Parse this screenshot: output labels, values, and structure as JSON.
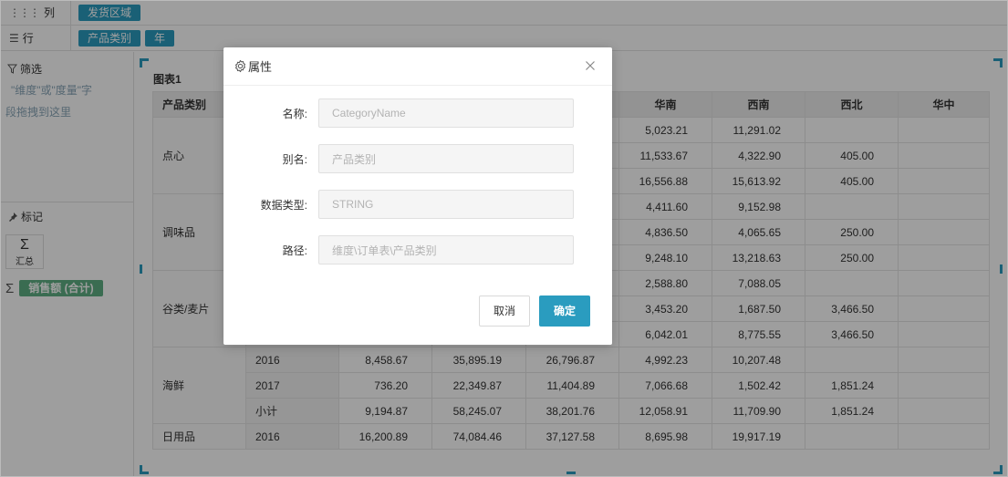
{
  "shelves": {
    "columns": {
      "label": "列",
      "pills": [
        "发货区域"
      ]
    },
    "rows": {
      "label": "行",
      "pills": [
        "产品类别",
        "年"
      ]
    }
  },
  "left_panel": {
    "filter": {
      "title": "筛选",
      "hint_line1": "\"维度\"或\"度量\"字",
      "hint_line2": "段拖拽到这里"
    },
    "marks": {
      "title": "标记",
      "sum_box_label": "汇总",
      "measure_pill": "销售额 (合计)"
    }
  },
  "chart": {
    "title": "图表1",
    "headers": [
      "产品类别",
      "",
      "",
      "",
      "",
      "华南",
      "西南",
      "西北",
      "华中"
    ],
    "categories": [
      "点心",
      "调味品",
      "谷类/麦片",
      "海鲜",
      "日用品"
    ],
    "rows": [
      {
        "cat": "",
        "year": "",
        "c1": "",
        "c2": "",
        "c3": "",
        "huanan": "5,023.21",
        "xinan": "11,291.02",
        "xibei": "",
        "huazhong": ""
      },
      {
        "cat": "",
        "year": "",
        "c1": "",
        "c2": "",
        "c3": "",
        "huanan": "11,533.67",
        "xinan": "4,322.90",
        "xibei": "405.00",
        "huazhong": ""
      },
      {
        "cat": "",
        "year": "",
        "c1": "",
        "c2": "",
        "c3": "",
        "huanan": "16,556.88",
        "xinan": "15,613.92",
        "xibei": "405.00",
        "huazhong": ""
      },
      {
        "cat": "",
        "year": "",
        "c1": "",
        "c2": "",
        "c3": "",
        "huanan": "4,411.60",
        "xinan": "9,152.98",
        "xibei": "",
        "huazhong": ""
      },
      {
        "cat": "",
        "year": "",
        "c1": "",
        "c2": "",
        "c3": "",
        "huanan": "4,836.50",
        "xinan": "4,065.65",
        "xibei": "250.00",
        "huazhong": ""
      },
      {
        "cat": "",
        "year": "",
        "c1": "",
        "c2": "",
        "c3": "",
        "huanan": "9,248.10",
        "xinan": "13,218.63",
        "xibei": "250.00",
        "huazhong": ""
      },
      {
        "cat": "",
        "year": "",
        "c1": "",
        "c2": "",
        "c3": "",
        "huanan": "2,588.80",
        "xinan": "7,088.05",
        "xibei": "",
        "huazhong": ""
      },
      {
        "cat": "",
        "year": "",
        "c1": "",
        "c2": "",
        "c3": "",
        "huanan": "3,453.20",
        "xinan": "1,687.50",
        "xibei": "3,466.50",
        "huazhong": ""
      },
      {
        "cat": "",
        "year": "",
        "c1": "",
        "c2": "",
        "c3": "",
        "huanan": "6,042.01",
        "xinan": "8,775.55",
        "xibei": "3,466.50",
        "huazhong": ""
      },
      {
        "cat": "",
        "year": "2016",
        "c1": "8,458.67",
        "c2": "35,895.19",
        "c3": "26,796.87",
        "huanan": "4,992.23",
        "xinan": "10,207.48",
        "xibei": "",
        "huazhong": ""
      },
      {
        "cat": "",
        "year": "2017",
        "c1": "736.20",
        "c2": "22,349.87",
        "c3": "11,404.89",
        "huanan": "7,066.68",
        "xinan": "1,502.42",
        "xibei": "1,851.24",
        "huazhong": ""
      },
      {
        "cat": "",
        "year": "小计",
        "c1": "9,194.87",
        "c2": "58,245.07",
        "c3": "38,201.76",
        "huanan": "12,058.91",
        "xinan": "11,709.90",
        "xibei": "1,851.24",
        "huazhong": ""
      },
      {
        "cat": "",
        "year": "2016",
        "c1": "16,200.89",
        "c2": "74,084.46",
        "c3": "37,127.58",
        "huanan": "8,695.98",
        "xinan": "19,917.19",
        "xibei": "",
        "huazhong": ""
      }
    ]
  },
  "dialog": {
    "title": "属性",
    "fields": [
      {
        "label": "名称:",
        "value": "CategoryName"
      },
      {
        "label": "别名:",
        "value": "产品类别"
      },
      {
        "label": "数据类型:",
        "value": "STRING"
      },
      {
        "label": "路径:",
        "value": "维度\\订单表\\产品类别"
      }
    ],
    "cancel_label": "取消",
    "ok_label": "确定"
  },
  "colors": {
    "accent": "#2a9cbf",
    "measure": "#5eae83"
  }
}
